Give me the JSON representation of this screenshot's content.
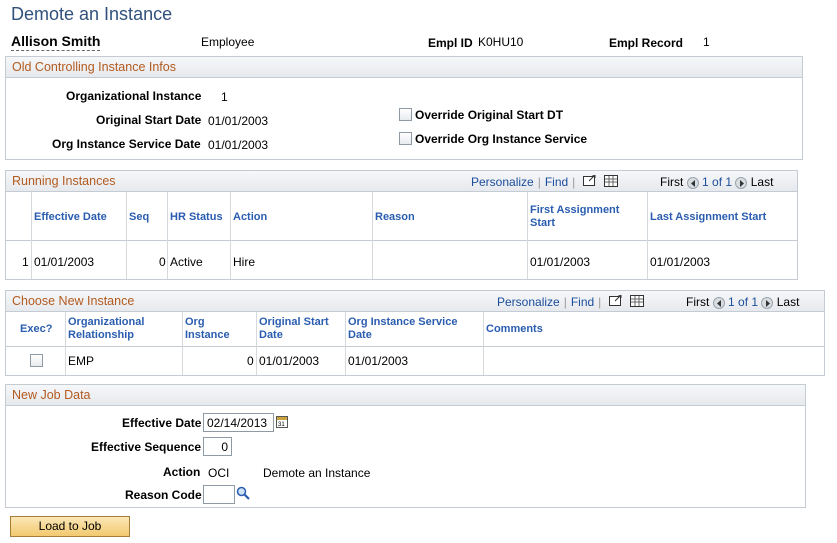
{
  "page": {
    "title": "Demote an Instance"
  },
  "employee": {
    "name": "Allison Smith",
    "type": "Employee",
    "empl_id_label": "Empl ID",
    "empl_id": "K0HU10",
    "empl_record_label": "Empl Record",
    "empl_record": "1"
  },
  "old_instance": {
    "title": "Old Controlling Instance Infos",
    "org_instance_label": "Organizational Instance",
    "org_instance": "1",
    "orig_start_label": "Original Start Date",
    "orig_start": "01/01/2003",
    "service_label": "Org Instance Service Date",
    "service": "01/01/2003",
    "override_start_label": "Override Original Start DT",
    "override_service_label": "Override Org Instance Service"
  },
  "running": {
    "title": "Running Instances",
    "personalize": "Personalize",
    "find": "Find",
    "first": "First",
    "pager": "1 of 1",
    "last": "Last",
    "headers": [
      "Effective Date",
      "Seq",
      "HR Status",
      "Action",
      "Reason",
      "First Assignment Start",
      "Last Assignment Start"
    ],
    "row": {
      "num": "1",
      "effdt": "01/01/2003",
      "seq": "0",
      "status": "Active",
      "action": "Hire",
      "reason": "",
      "first": "01/01/2003",
      "last": "01/01/2003"
    }
  },
  "choose": {
    "title": "Choose New Instance",
    "personalize": "Personalize",
    "find": "Find",
    "first": "First",
    "pager": "1 of 1",
    "last": "Last",
    "headers": [
      "Exec?",
      "Organizational Relationship",
      "Org Instance",
      "Original Start Date",
      "Org Instance Service Date",
      "Comments"
    ],
    "row": {
      "rel": "EMP",
      "inst": "0",
      "start": "01/01/2003",
      "service": "01/01/2003",
      "comments": ""
    }
  },
  "newjob": {
    "title": "New Job Data",
    "effdt_label": "Effective Date",
    "effdt": "02/14/2013",
    "effseq_label": "Effective Sequence",
    "effseq": "0",
    "action_label": "Action",
    "action_code": "OCI",
    "action_desc": "Demote an Instance",
    "reason_label": "Reason Code",
    "reason": ""
  },
  "buttons": {
    "load": "Load to Job"
  },
  "colors": {
    "title": "#31517d",
    "section_title": "#b35a1f",
    "link": "#2a5db0",
    "button": "#f2c96f"
  }
}
